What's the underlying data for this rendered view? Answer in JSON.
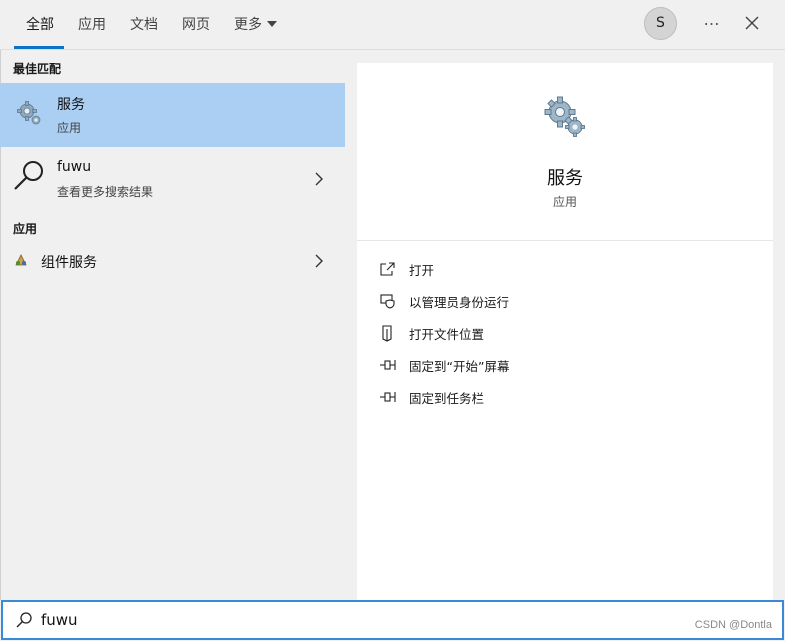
{
  "tabs": [
    {
      "label": "全部"
    },
    {
      "label": "应用"
    },
    {
      "label": "文档"
    },
    {
      "label": "网页"
    },
    {
      "label": "更多"
    }
  ],
  "account": {
    "initial": "S"
  },
  "header_icons": {
    "more": "…",
    "close": "close-icon"
  },
  "best_match": {
    "section_label": "最佳匹配",
    "title": "服务",
    "subtitle": "应用"
  },
  "web_search": {
    "title": "fuwu",
    "subtitle": "查看更多搜索结果"
  },
  "apps": {
    "section_label": "应用",
    "items": [
      {
        "label": "组件服务"
      }
    ]
  },
  "detail": {
    "title": "服务",
    "subtitle": "应用",
    "actions": [
      {
        "label": "打开",
        "icon": "open-icon"
      },
      {
        "label": "以管理员身份运行",
        "icon": "shield-icon"
      },
      {
        "label": "打开文件位置",
        "icon": "file-location-icon"
      },
      {
        "label": "固定到“开始”屏幕",
        "icon": "pin-icon"
      },
      {
        "label": "固定到任务栏",
        "icon": "pin-icon"
      }
    ]
  },
  "search": {
    "value": "fuwu"
  },
  "watermark": "CSDN @Dontla",
  "colors": {
    "accent": "#0a73c8",
    "selection": "#aacff3",
    "search_border": "#3a8ad8"
  }
}
